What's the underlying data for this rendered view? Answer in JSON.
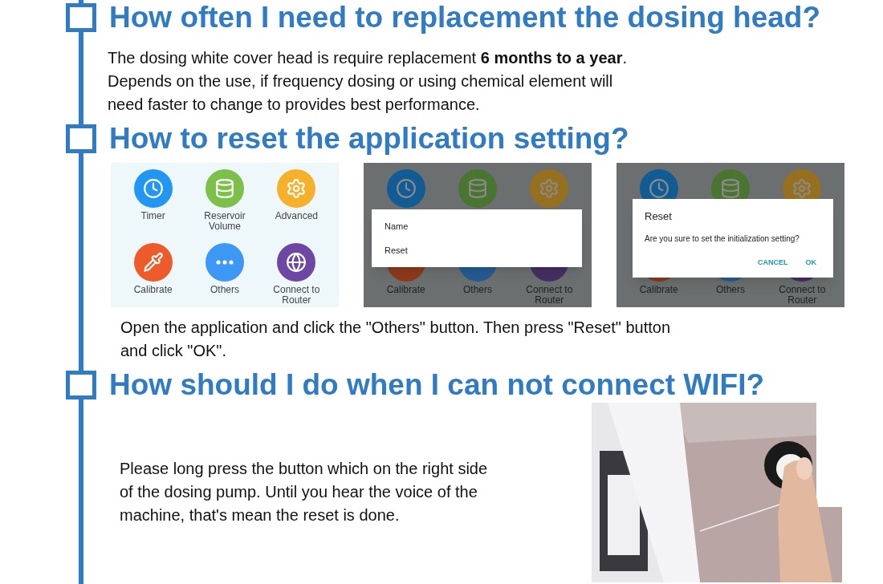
{
  "sections": [
    {
      "heading": "How often I need to replacement the dosing head?",
      "kind": "text",
      "lines": [
        "The dosing white cover head is require replacement **6 months to a year**.",
        "Depends on the use, if frequency dosing or using chemical element will",
        "need faster to change to provides best performance."
      ]
    },
    {
      "heading": "How to reset the application setting?",
      "kind": "screens",
      "screens": [
        {
          "kind": "grid",
          "tiles": [
            {
              "label": "Timer",
              "color": "#2196f3"
            },
            {
              "label": "Reservoir Volume",
              "color": "#7cc04a"
            },
            {
              "label": "Advanced",
              "color": "#f6b12a"
            },
            {
              "label": "Calibrate",
              "color": "#ef5a2a"
            },
            {
              "label": "Others",
              "color": "#3d97f5"
            },
            {
              "label": "Connect to Router",
              "color": "#6e47a4"
            }
          ]
        },
        {
          "kind": "menu",
          "items": [
            "Name",
            "Reset"
          ],
          "tiles": [
            {
              "color": "#125c96"
            },
            {
              "color": "#4a7530"
            },
            {
              "color": "#96701e"
            },
            {
              "label": "Calibrate",
              "color": "#8f3a1c"
            },
            {
              "label": "Others",
              "color": "#255c94"
            },
            {
              "label": "Connect to Router",
              "color": "#452f63"
            }
          ]
        },
        {
          "kind": "dialog",
          "title": "Reset",
          "message": "Are you sure to set the initialization setting?",
          "buttons": [
            "CANCEL",
            "OK"
          ],
          "tiles": [
            {
              "color": "#125c96"
            },
            {
              "color": "#4a7530"
            },
            {
              "color": "#96701e"
            },
            {
              "label": "Calibrate",
              "color": "#8f3a1c"
            },
            {
              "label": "Others",
              "color": "#255c94"
            },
            {
              "label": "Connect to Router",
              "color": "#452f63"
            }
          ]
        }
      ],
      "lines": [
        "Open the application and click the \"Others\" button. Then press \"Reset\" button",
        "and click \"OK\"."
      ]
    },
    {
      "heading": "How should I do when I can not connect WIFI?",
      "lines": [
        "Please long press the button which on the right side",
        "of the dosing pump. Until you hear the voice of the",
        "machine, that's mean the reset is done."
      ]
    }
  ]
}
